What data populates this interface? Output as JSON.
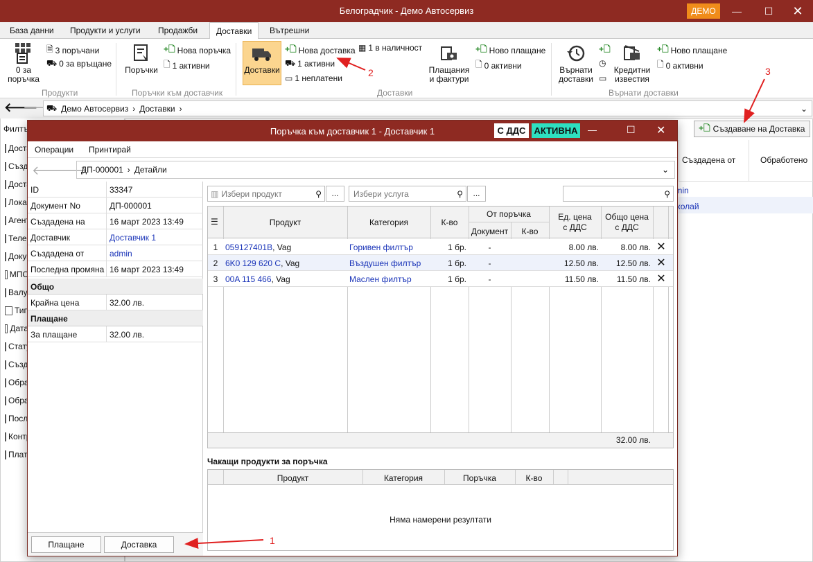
{
  "app": {
    "title": "Белоградчик - Демо Автосервиз",
    "demo_badge": "ДЕМО"
  },
  "tabs": [
    "База данни",
    "Продукти и услуги",
    "Продажби",
    "Доставки",
    "Вътрешни"
  ],
  "ribbon": {
    "products": {
      "big_label": "0 за\nпоръчка",
      "items": [
        "3 поръчани",
        "0 за връщане"
      ],
      "group": "Продукти"
    },
    "supplier_orders": {
      "big_label": "Поръчки",
      "items": [
        "Нова поръчка",
        "1 активни"
      ],
      "group": "Поръчки към доставчик"
    },
    "deliveries": {
      "big_label": "Доставки",
      "items": [
        "Нова доставка",
        "1 активни",
        "1 неплатени",
        "1 в наличност"
      ],
      "payments_label": "Плащания\nи фактури",
      "items2": [
        "Ново плащане",
        "0 активни"
      ],
      "group": "Доставки"
    },
    "returned": {
      "big_label": "Върнати\nдоставки",
      "credit_label": "Кредитни\nизвестия",
      "items": [
        "Ново плащане",
        "0 активни"
      ],
      "group": "Върнати доставки"
    }
  },
  "address": {
    "crumbs": [
      "Демо Автосервиз",
      "Доставки"
    ]
  },
  "background": {
    "filters_label": "Филтъ",
    "filters": [
      "Доставчик",
      "Създадена",
      "Доставчик",
      "Локация",
      "Агент",
      "Телефон",
      "Документ",
      "МПС",
      "Валута",
      "Тип",
      "Дата",
      "Статус",
      "Създадена от",
      "Обработено",
      "Обработено от",
      "Последна",
      "Контрагент",
      "Платено"
    ],
    "create_button": "Създаване на Доставка",
    "col_created_by": "Създадена от",
    "col_processed": "Обработено",
    "rows": [
      "admin",
      "Николай"
    ]
  },
  "window": {
    "title": "Поръчка към доставчик 1 - Доставчик 1",
    "vat_badge": "С ДДС",
    "status_badge": "АКТИВНА",
    "menu": [
      "Операции",
      "Принтирай"
    ],
    "crumbs": [
      "ДП-000001",
      "Детайли"
    ],
    "details": [
      {
        "label": "ID",
        "value": "33347",
        "link": false
      },
      {
        "label": "Документ No",
        "value": "ДП-000001",
        "link": false
      },
      {
        "label": "Създадена на",
        "value": "16 март 2023 13:49",
        "link": false
      },
      {
        "label": "Доставчик",
        "value": "Доставчик 1",
        "link": true
      },
      {
        "label": "Създадена от",
        "value": "admin",
        "link": true
      },
      {
        "label": "Последна промяна",
        "value": "16 март 2023 13:49",
        "link": false
      }
    ],
    "total_section": "Общо",
    "total_label": "Крайна цена",
    "total_value": "32.00 лв.",
    "payment_section": "Плащане",
    "payment_label": "За плащане",
    "payment_value": "32.00 лв.",
    "product_search_placeholder": "Избери продукт",
    "service_search_placeholder": "Избери услуга",
    "more_button": "...",
    "table": {
      "headers": {
        "product": "Продукт",
        "category": "Категория",
        "qty": "К-во",
        "from_order": "От поръчка",
        "document": "Документ",
        "from_qty": "К-во",
        "unit_price": "Ед. цена\nс ДДС",
        "total_price": "Общо цена\nс ДДС"
      },
      "rows": [
        {
          "n": "1",
          "code": "059127401B",
          "brand": ", Vag",
          "category": "Горивен филтър",
          "qty": "1 бр.",
          "doc": "-",
          "unit": "8.00 лв.",
          "total": "8.00 лв."
        },
        {
          "n": "2",
          "code": "6K0 129 620 C",
          "brand": ", Vag",
          "category": "Въздушен филтър",
          "qty": "1 бр.",
          "doc": "-",
          "unit": "12.50 лв.",
          "total": "12.50 лв."
        },
        {
          "n": "3",
          "code": "00A 115 466",
          "brand": ", Vag",
          "category": "Маслен филтър",
          "qty": "1 бр.",
          "doc": "-",
          "unit": "11.50 лв.",
          "total": "11.50 лв."
        }
      ],
      "footer_total": "32.00 лв."
    },
    "waiting": {
      "title": "Чакащи продукти за поръчка",
      "headers": [
        "Продукт",
        "Категория",
        "Поръчка",
        "К-во"
      ],
      "empty": "Няма намерени резултати"
    },
    "buttons": {
      "payment": "Плащане",
      "delivery": "Доставка"
    }
  },
  "annotations": [
    "1",
    "2",
    "3"
  ],
  "colors": {
    "titlebar": "#8e2a22",
    "accent_demo": "#f08c1a",
    "active_badge": "#2ee0c0",
    "link": "#1a34b8",
    "arrow": "#e02020"
  }
}
